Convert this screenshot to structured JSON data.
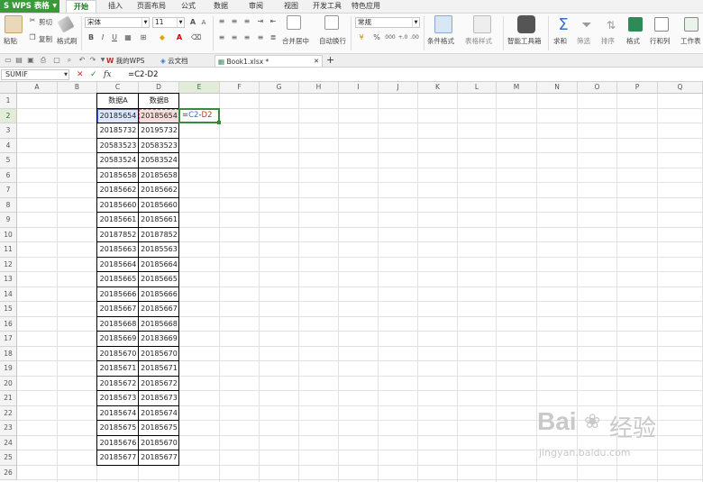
{
  "app": {
    "name": "WPS 表格",
    "name_badge": "S"
  },
  "menu_tabs": [
    "开始",
    "插入",
    "页面布局",
    "公式",
    "数据",
    "审阅",
    "视图",
    "开发工具",
    "特色应用"
  ],
  "ribbon": {
    "paste": "粘贴",
    "cut": "剪切",
    "copy": "复制",
    "format_painter": "格式刷",
    "font_name": "宋体",
    "font_size": "11",
    "merge_center": "合并居中",
    "wrap": "自动换行",
    "number_format": "常规",
    "cond_format": "条件格式",
    "table_style": "表格样式",
    "smart_toolbox": "智能工具箱",
    "sum": "求和",
    "filter": "筛选",
    "sort": "排序",
    "format": "格式",
    "rows_cols": "行和列",
    "worksheet": "工作表",
    "bold": "B",
    "italic": "I",
    "underline": "U",
    "percent": "%",
    "thousands": "000",
    "inc_decimal": "+.0",
    "dec_decimal": ".00"
  },
  "doc_tabs": {
    "mywps": "我的WPS",
    "cloud": "云文档",
    "book": "Book1.xlsx *",
    "new_tab": "+"
  },
  "formula_bar": {
    "name_box": "SUMIF",
    "fx": "fx",
    "cancel": "✕",
    "confirm": "✓",
    "formula": "=C2-D2"
  },
  "columns": [
    "A",
    "B",
    "C",
    "D",
    "E",
    "F",
    "G",
    "H",
    "I",
    "J",
    "K",
    "L",
    "M",
    "N",
    "O",
    "P",
    "Q"
  ],
  "row_count": 26,
  "table": {
    "header_a": "数据A",
    "header_b": "数据B",
    "rows": [
      [
        "20185654",
        "20185654"
      ],
      [
        "20185732",
        "20195732"
      ],
      [
        "20583523",
        "20583523"
      ],
      [
        "20583524",
        "20583524"
      ],
      [
        "20185658",
        "20185658"
      ],
      [
        "20185662",
        "20185662"
      ],
      [
        "20185660",
        "20185660"
      ],
      [
        "20185661",
        "20185661"
      ],
      [
        "20187852",
        "20187852"
      ],
      [
        "20185663",
        "20185563"
      ],
      [
        "20185664",
        "20185664"
      ],
      [
        "20185665",
        "20185665"
      ],
      [
        "20185666",
        "20185666"
      ],
      [
        "20185667",
        "20185667"
      ],
      [
        "20185668",
        "20185668"
      ],
      [
        "20185669",
        "20183669"
      ],
      [
        "20185670",
        "20185670"
      ],
      [
        "20185671",
        "20185671"
      ],
      [
        "20185672",
        "20185672"
      ],
      [
        "20185673",
        "20185673"
      ],
      [
        "20185674",
        "20185674"
      ],
      [
        "20185675",
        "20185675"
      ],
      [
        "20185676",
        "20185670"
      ],
      [
        "20185677",
        "20185677"
      ]
    ]
  },
  "active_cell": {
    "col": "E",
    "row": "2",
    "edit_prefix": "=",
    "ref1": "C2",
    "op": "-",
    "ref2": "D2"
  },
  "watermark": {
    "brand": "Bai",
    "brand_cn": "经验",
    "url": "jingyan.baidu.com"
  },
  "colors": {
    "accent": "#3a9a3a",
    "ref_blue": "#4169e1",
    "ref_red": "#d9534f"
  }
}
